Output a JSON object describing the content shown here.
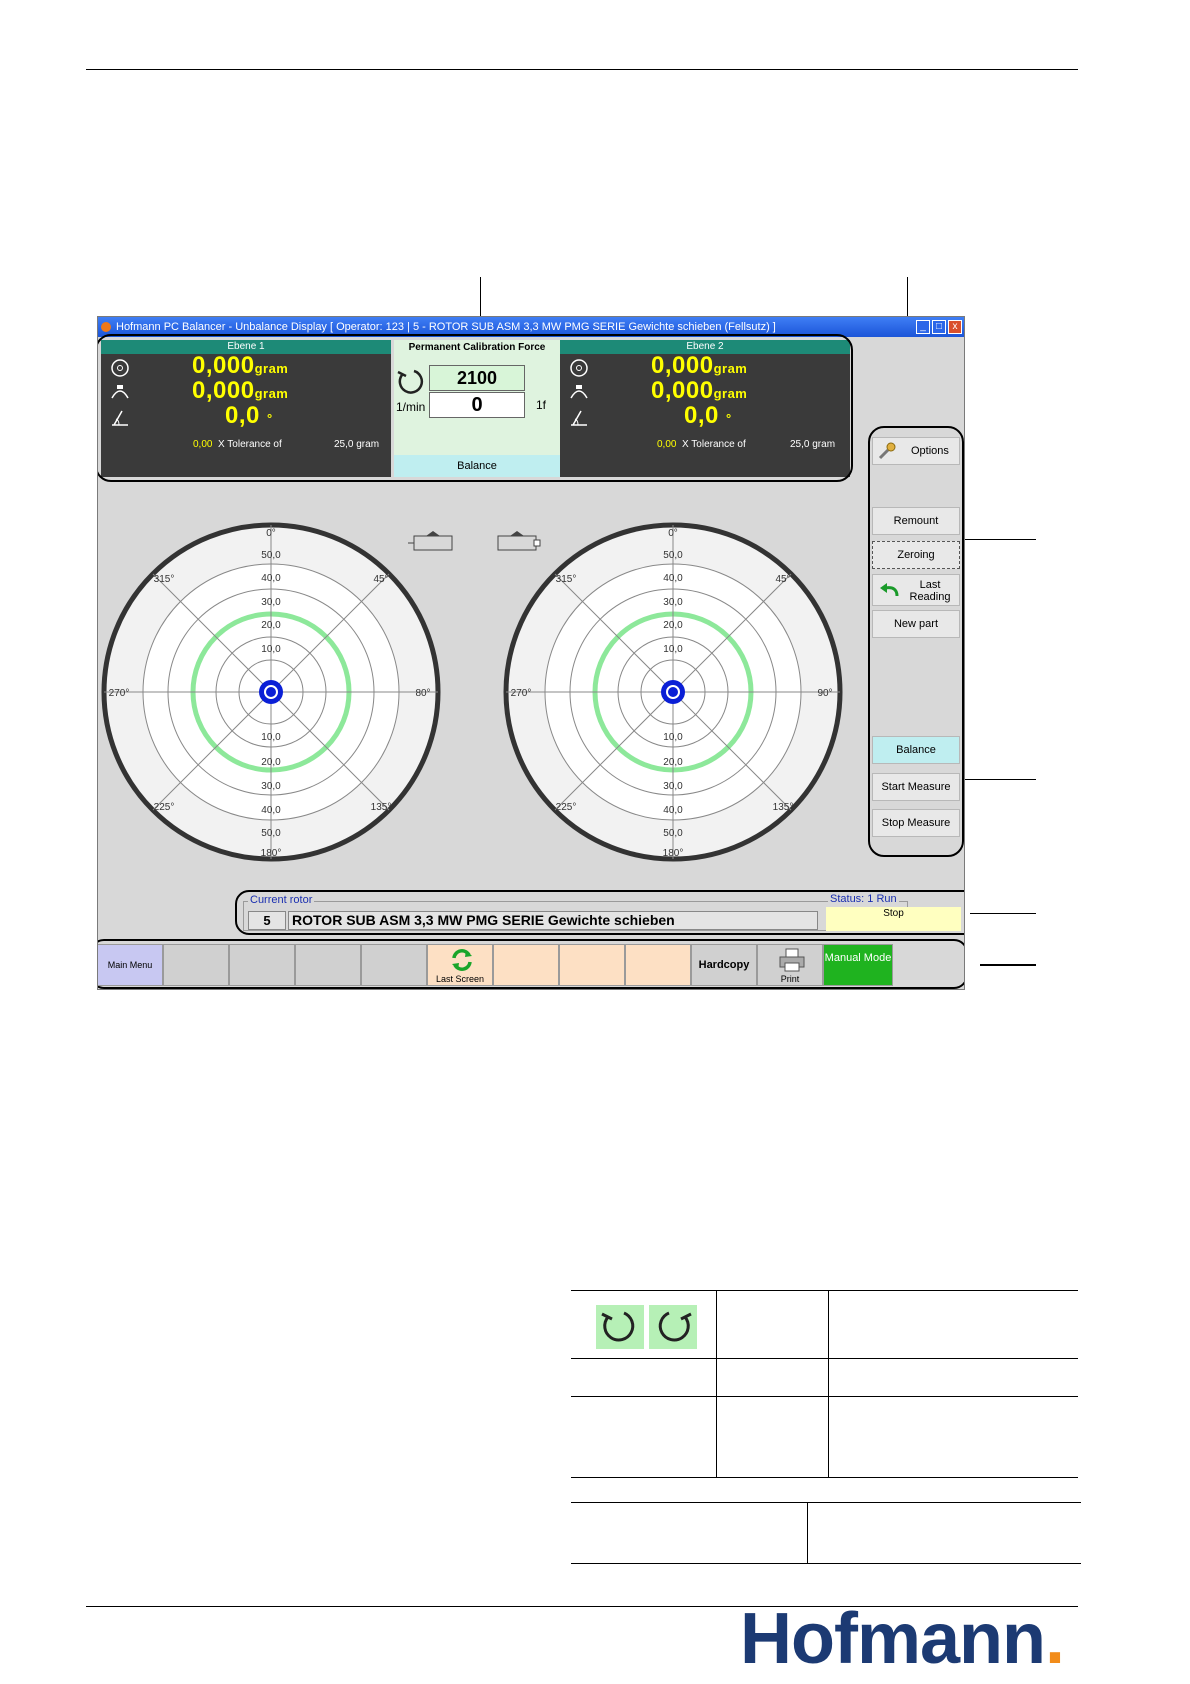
{
  "window": {
    "title": "Hofmann PC Balancer - Unbalance Display [ Operator: 123 | 5 - ROTOR SUB ASM 3,3 MW PMG SERIE Gewichte schieben (Fellsutz) ]",
    "btn_min": "_",
    "btn_max": "□",
    "btn_close": "x"
  },
  "plane1": {
    "header": "Ebene 1",
    "mass1": "0,000",
    "mass2": "0,000",
    "unit": "gram",
    "angle": "0,0",
    "angle_unit": "°",
    "tol_value": "0,00",
    "tol_label": "X Tolerance of",
    "tol_limit": "25,0 gram"
  },
  "plane2": {
    "header": "Ebene 2",
    "mass1": "0,000",
    "mass2": "0,000",
    "unit": "gram",
    "angle": "0,0",
    "angle_unit": "°",
    "tol_value": "0,00",
    "tol_label": "X Tolerance of",
    "tol_limit": "25,0 gram"
  },
  "calibration": {
    "title": "Permanent Calibration Force",
    "speed_set": "2100",
    "speed_unit": "1/min",
    "speed_actual": "0",
    "harmonic": "1f",
    "status": "Balance"
  },
  "right_panel": {
    "options": "Options",
    "remount": "Remount",
    "zeroing": "Zeroing",
    "last_reading": "Last Reading",
    "new_part": "New part",
    "balance": "Balance",
    "start_measure": "Start Measure",
    "stop_measure": "Stop Measure"
  },
  "polar_labels": {
    "deg0": "0°",
    "deg45": "45°",
    "deg90": "90°",
    "deg135": "135°",
    "deg180": "180°",
    "deg225": "225°",
    "deg270": "270°",
    "deg315": "315°",
    "left_deg90": "80°",
    "r10": "10,0",
    "r20": "20,0",
    "r30": "30,0",
    "r40": "40,0",
    "r50": "50,0"
  },
  "status": {
    "rotor_label": "Current rotor",
    "rotor_no": "5",
    "rotor_name": "ROTOR SUB ASM 3,3 MW PMG SERIE Gewichte schieben",
    "status_label": "Status: 1 Run",
    "status_value": "Stop"
  },
  "toolbar": {
    "main_menu": "Main Menu",
    "last_screen": "Last Screen",
    "hardcopy": "Hardcopy",
    "print": "Print",
    "manual_mode": "Manual Mode"
  },
  "colors": {
    "titlebar": "#1b55d8",
    "plane_bg": "#3a3a3a",
    "value_yellow": "#ffff00",
    "header_teal": "#1d8a77",
    "tolerance_ring": "#8de89a",
    "center_dot": "#0a1fd6",
    "manual_green": "#1fb31f",
    "tool_peach": "#fde0c4",
    "status_yellow": "#ffffc0",
    "logo_blue": "#1c3a73",
    "logo_orange": "#f28c1a"
  },
  "logo": {
    "text": "Hofmann",
    "dot": "."
  }
}
